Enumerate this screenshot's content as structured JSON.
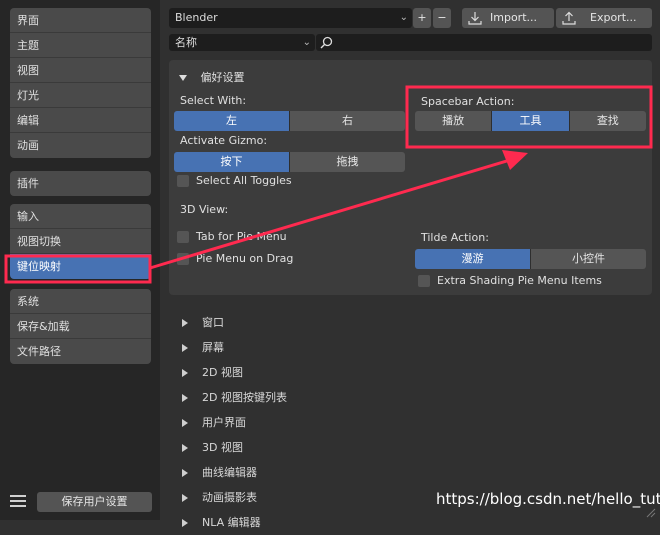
{
  "sidebar": {
    "groups": [
      [
        "界面",
        "主题",
        "视图",
        "灯光",
        "编辑",
        "动画"
      ],
      [
        "插件"
      ],
      [
        "输入",
        "视图切换",
        "键位映射"
      ],
      [
        "系统",
        "保存&加载",
        "文件路径"
      ]
    ],
    "active": "键位映射",
    "save_button": "保存用户设置"
  },
  "header": {
    "preset": "Blender",
    "add": "+",
    "remove": "−",
    "import": "Import...",
    "export": "Export...",
    "filter_type": "名称"
  },
  "prefs": {
    "title": "偏好设置",
    "select_with": {
      "label": "Select With:",
      "options": [
        "左",
        "右"
      ],
      "selected": "左"
    },
    "activate_gizmo": {
      "label": "Activate Gizmo:",
      "options": [
        "按下",
        "拖拽"
      ],
      "selected": "按下"
    },
    "select_all_toggles": "Select All Toggles",
    "spacebar_action": {
      "label": "Spacebar Action:",
      "options": [
        "播放",
        "工具",
        "查找"
      ],
      "selected": "工具"
    },
    "view3d_label": "3D View:",
    "tab_pie_menu": "Tab for Pie Menu",
    "pie_menu_drag": "Pie Menu on Drag",
    "tilde_action": {
      "label": "Tilde Action:",
      "options": [
        "漫游",
        "小控件"
      ],
      "selected": "漫游"
    },
    "extra_shading": "Extra Shading Pie Menu Items"
  },
  "keymap_sections": [
    "窗口",
    "屏幕",
    "2D 视图",
    "2D 视图按键列表",
    "用户界面",
    "3D 视图",
    "曲线编辑器",
    "动画摄影表",
    "NLA 编辑器"
  ],
  "watermark": "https://blog.csdn.net/hello_tute",
  "colors": {
    "accent": "#4772b3",
    "highlight": "#ff2a4f"
  }
}
